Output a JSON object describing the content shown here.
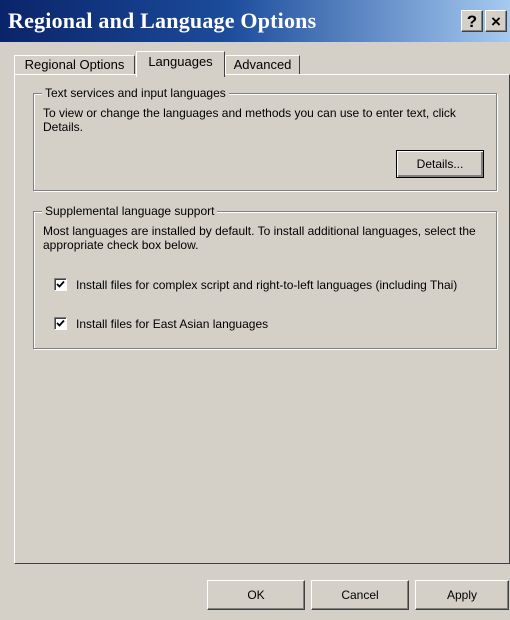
{
  "window": {
    "title": "Regional and Language Options",
    "help_button": "?",
    "close_button": "×"
  },
  "tabs": [
    {
      "label": "Regional Options",
      "active": false
    },
    {
      "label": "Languages",
      "active": true
    },
    {
      "label": "Advanced",
      "active": false
    }
  ],
  "text_services": {
    "group_label": "Text services and input languages",
    "description": "To view or change the languages and methods you can use to enter text, click Details.",
    "details_button": "Details..."
  },
  "supplemental": {
    "group_label": "Supplemental language support",
    "description": "Most languages are installed by default. To install additional languages, select the appropriate check box below.",
    "checkboxes": [
      {
        "label": "Install files for complex script and right-to-left languages (including Thai)",
        "checked": true
      },
      {
        "label": "Install files for East Asian languages",
        "checked": true
      }
    ]
  },
  "footer": {
    "ok": "OK",
    "cancel": "Cancel",
    "apply": "Apply"
  }
}
